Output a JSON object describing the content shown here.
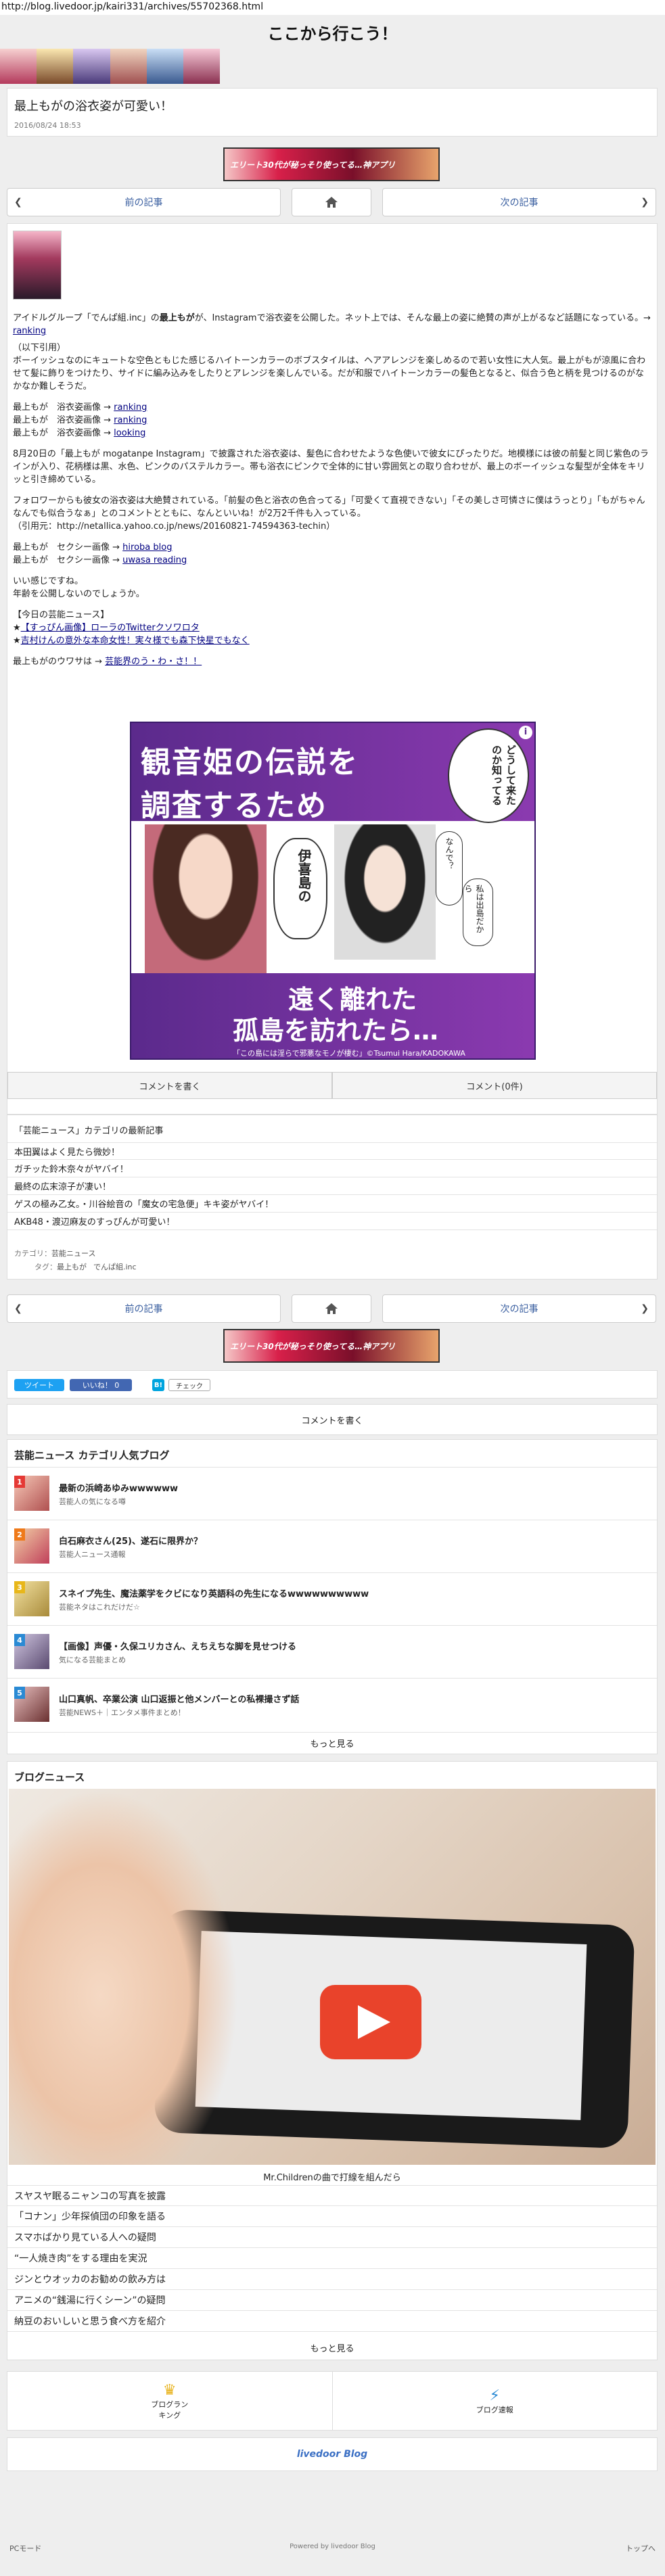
{
  "url": "http://blog.livedoor.jp/kairi331/archives/55702368.html",
  "site_title": "ここから行こう！",
  "post": {
    "title": "最上もがの浴衣姿が可愛い！",
    "date": "2016/08/24 18:53"
  },
  "nav": {
    "prev": "前の記事",
    "next": "次の記事"
  },
  "ad": {
    "text": "エリート30代が秘っそり使ってる…神アプリ"
  },
  "article": {
    "p1_pre": "アイドルグループ「でんぱ組.inc」の",
    "p1_bold": "最上もが",
    "p1_post": "が、Instagramで浴衣姿を公開した。ネット上では、そんな最上の姿に絶賛の声が上がるなど話題になっている。→ ",
    "p1_link": "ranking",
    "quote_label": "（以下引用）",
    "p2": "ボーイッシュなのにキュートな空色ともじた感じるハイトーンカラーのボブスタイルは、ヘアアレンジを楽しめるので若い女性に大人気。最上がもが涼風に合わせて髪に飾りをつけたり、サイドに編み込みをしたりとアレンジを楽しんでいる。だが和服でハイトーンカラーの髪色となると、似合う色と柄を見つけるのがなかなか難しそうだ。",
    "links1": [
      {
        "pre": "最上もが　浴衣姿画像 → ",
        "link": "ranking"
      },
      {
        "pre": "最上もが　浴衣姿画像 → ",
        "link": "ranking"
      },
      {
        "pre": "最上もが　浴衣姿画像 → ",
        "link": "looking"
      }
    ],
    "p3": "8月20日の「最上もが mogatanpe Instagram」で披露された浴衣姿は、髪色に合わせたような色使いで彼女にぴったりだ。地模様には彼の前髪と同じ紫色のラインが入り、花柄様は黒、水色、ピンクのパステルカラー。帯も浴衣にピンクで全体的に甘い雰囲気との取り合わせが、最上のボーイッシュな髪型が全体をキリッと引き締めている。",
    "p4": "フォロワーからも彼女の浴衣姿は大絶賛されている。「前髪の色と浴衣の色合ってる」「可愛くて直視できない」「その美しさ可憐さに僕はうっとり」「もがちゃんなんでも似合うなぁ」とのコメントとともに、なんといいね！が2万2千件も入っている。",
    "source": "（引用元：http://netallica.yahoo.co.jp/news/20160821-74594363-techin）",
    "links2": [
      {
        "pre": "最上もが　セクシー画像 → ",
        "link": "hiroba blog"
      },
      {
        "pre": "最上もが　セクシー画像 → ",
        "link": "uwasa reading"
      }
    ],
    "p5a": "いい感じですね。",
    "p5b": "年齢を公開しないのでしょうか。",
    "news_heading": "【今日の芸能ニュース】",
    "news": [
      "【すっぴん画像】ローラのTwitterクソワロタ",
      "吉村けんの意外な本命女性！実々様でも森下快星でもなく"
    ],
    "footer_pre": "最上もがのウワサは → ",
    "footer_link": "芸能界のう・わ・さ！！"
  },
  "manga": {
    "title_line1": "観音姫の伝説を",
    "title_line2": "調査するため",
    "bubble1": "伊喜島の",
    "bubble2": "なんで？",
    "bubble3": "どうして来たのか知ってる",
    "bubble4": "私は出島だから",
    "bottom_line1": "遠く離れた",
    "bottom_line2": "孤島を訪れたら…",
    "caption": "「この島には淫らで邪悪なモノが棲む」©Tsumui Hara/KADOKAWA"
  },
  "comment_buttons": {
    "write": "コメントを書く",
    "count": "コメント(0件)"
  },
  "category_latest": {
    "heading": "「芸能ニュース」カテゴリの最新記事",
    "items": [
      "本田翼はよく見たら微妙！",
      "ガチッた鈴木奈々がヤバイ！",
      "最終の広末涼子が凄い！",
      "ゲスの極み乙女。・川谷絵音の「魔女の宅急便」キキ姿がヤバイ！",
      "AKB48・渡辺麻友のすっぴんが可愛い！"
    ],
    "category_label": "カテゴリ：",
    "category_value": "芸能ニュース",
    "tag_label": "タグ：",
    "tags": [
      "最上もが",
      "でんぱ組.inc"
    ]
  },
  "social": {
    "tweet": "ツイート",
    "like": "いいね！ 0",
    "hatena": "B!",
    "check": "チェック"
  },
  "comment_write": "コメントを書く",
  "popular": {
    "heading": "芸能ニュース カテゴリ人気ブログ",
    "items": [
      {
        "rank": "1",
        "title": "最新の浜崎あゆみwwwwww",
        "sub": "芸能人の気になる噂"
      },
      {
        "rank": "2",
        "title": "白石麻衣さん(25)、遂石に限界か？",
        "sub": "芸能人ニュース通報"
      },
      {
        "rank": "3",
        "title": "スネイプ先生、魔法薬学をクビになり英語科の先生になるwwwwwwwwww",
        "sub": "芸能ネタはこれだけだ☆"
      },
      {
        "rank": "4",
        "title": "【画像】声優・久保ユリカさん、えちえちな脚を見せつける",
        "sub": "気になる芸能まとめ"
      },
      {
        "rank": "5",
        "title": "山口真帆、卒業公演 山口返振と他メンバーとの私裸撮さず話",
        "sub": "芸能NEWS＋｜エンタメ事件まとめ！"
      }
    ],
    "more": "もっと見る"
  },
  "blog_news": {
    "heading": "ブログニュース",
    "caption": "Mr.Childrenの曲で打線を組んだら",
    "items": [
      "スヤスヤ眠るニャンコの写真を披露",
      "「コナン」少年探偵団の印象を語る",
      "スマホばかり見ている人への疑問",
      "“一人焼き肉”をする理由を実況",
      "ジンとウオッカのお勧めの飲み方は",
      "アニメの“銭湯に行くシーン”の疑問",
      "納豆のおいしいと思う食べ方を紹介"
    ],
    "more": "もっと見る"
  },
  "footer_links": {
    "ranking": "ブログランキング",
    "news": "ブログ速報"
  },
  "livedoor_logo": "livedoor Blog",
  "bottom_bar": {
    "pc": "PCモード",
    "powered": "Powered by livedoor Blog",
    "top": "トップへ"
  }
}
